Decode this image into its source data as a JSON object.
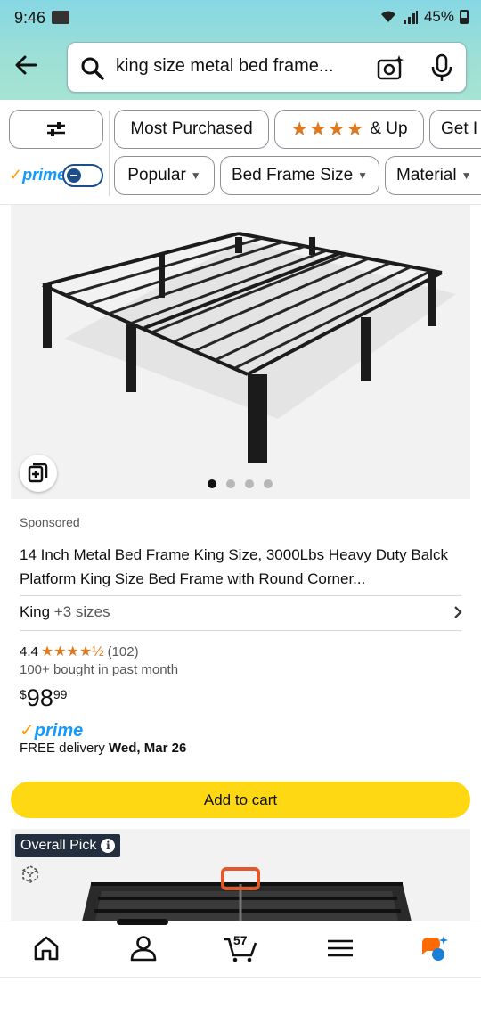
{
  "status_bar": {
    "time": "9:46",
    "battery": "45%"
  },
  "search": {
    "query": "king size metal bed frame..."
  },
  "filters": {
    "row1": [
      "Most Purchased",
      "& Up",
      "Get I"
    ],
    "row1_stars": "★★★★",
    "prime_label": "prime",
    "row2": [
      "Popular",
      "Bed Frame Size",
      "Material"
    ]
  },
  "product": {
    "sponsored": "Sponsored",
    "title": "14 Inch Metal Bed Frame King Size, 3000Lbs Heavy Duty Balck Platform King Size Bed Frame with Round Corner...",
    "size": "King",
    "more_sizes": "+3 sizes",
    "rating_value": "4.4",
    "rating_stars": 4.4,
    "rating_count": "(102)",
    "bought": "100+ bought in past month",
    "price_symbol": "$",
    "price_whole": "98",
    "price_fraction": "99",
    "prime": "prime",
    "delivery_prefix": "FREE delivery",
    "delivery_date": "Wed, Mar 26",
    "add_to_cart": "Add to cart",
    "image_dots": 4,
    "active_dot": 0
  },
  "next_product": {
    "badge": "Overall Pick",
    "info_glyph": "i"
  },
  "bottom_nav": {
    "cart_count": "57",
    "items": [
      "home-icon",
      "account-icon",
      "cart-icon",
      "menu-icon",
      "rufus-icon"
    ]
  },
  "colors": {
    "header_gradient_top": "#86d7e3",
    "add_to_cart": "#ffd814",
    "star": "#de7921",
    "prime_blue": "#1399ff",
    "badge_dark": "#232f3e"
  }
}
